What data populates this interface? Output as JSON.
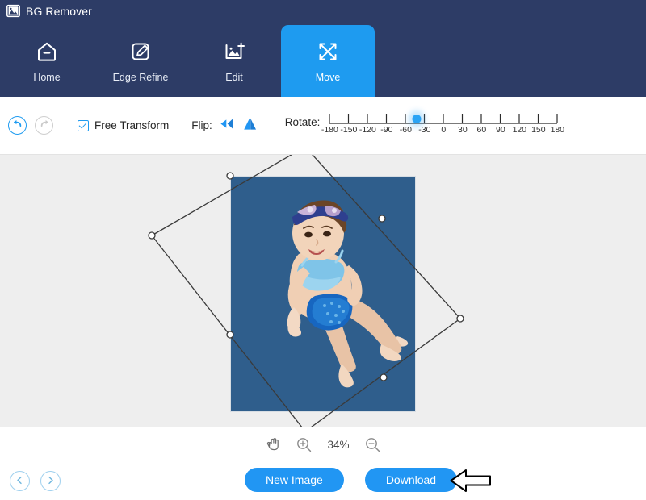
{
  "app": {
    "title": "BG Remover",
    "logo_icon": "image-mountain-icon",
    "header_color": "#2d3c66",
    "accent_color": "#1e9bf0",
    "button_color": "#2196f3",
    "canvas_color": "#eeeeee",
    "photo_background_color": "#2f5e8c"
  },
  "tabs": [
    {
      "label": "Home",
      "icon": "home-icon",
      "active": false
    },
    {
      "label": "Edge Refine",
      "icon": "edge-refine-pen-icon",
      "active": false
    },
    {
      "label": "Edit",
      "icon": "edit-image-icon",
      "active": false
    },
    {
      "label": "Move",
      "icon": "move-arrows-icon",
      "active": true
    }
  ],
  "toolbar": {
    "undo_icon": "undo-arrow-icon",
    "redo_icon": "redo-arrow-icon",
    "undo_enabled": true,
    "redo_enabled": false,
    "free_transform": {
      "label": "Free Transform",
      "checked": true,
      "check_icon": "checkbox-checked-icon"
    },
    "flip": {
      "label": "Flip:",
      "horizontal_icon": "flip-horizontal-icon",
      "vertical_icon": "flip-vertical-icon"
    },
    "rotate": {
      "label": "Rotate:",
      "value": -42,
      "min": -180,
      "max": 180,
      "ticks": [
        -180,
        -150,
        -120,
        -90,
        -60,
        -30,
        0,
        30,
        60,
        90,
        120,
        150,
        180
      ]
    }
  },
  "canvas": {
    "photo_alt": "baby-in-blue-swimsuit-on-blue-background",
    "selection": {
      "rotation_degrees": -42,
      "corner_handles": 4,
      "edge_handles": 4
    }
  },
  "zoombar": {
    "hand_tool_icon": "hand-tool-icon",
    "zoom_in_icon": "zoom-in-icon",
    "zoom_out_icon": "zoom-out-icon",
    "level": "34%"
  },
  "footer": {
    "prev_icon": "chevron-left-icon",
    "next_icon": "chevron-right-icon",
    "new_image_label": "New Image",
    "download_label": "Download",
    "pointer_icon": "left-arrow-cursor-icon"
  }
}
